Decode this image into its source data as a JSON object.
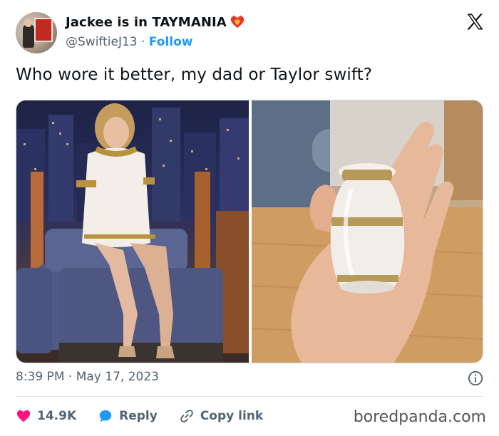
{
  "tweet": {
    "author": {
      "name": "Jackee is in TAYMANIA",
      "handle": "@SwiftieJ13",
      "separator": "·",
      "follow_label": "Follow"
    },
    "text": "Who wore it better, my dad or Taylor swift?",
    "timestamp": "8:39 PM · May 17, 2023"
  },
  "actions": {
    "likes": "14.9K",
    "reply_label": "Reply",
    "copy_link_label": "Copy link"
  },
  "watermark": "boredpanda.com",
  "icons": [
    "avatar",
    "heart-fire-badge-icon",
    "x-logo-icon",
    "info-icon",
    "heart-icon",
    "reply-bubble-icon",
    "link-icon"
  ],
  "colors": {
    "accent": "#1d9bf0",
    "like": "#f91880",
    "secondary_text": "#536471"
  }
}
